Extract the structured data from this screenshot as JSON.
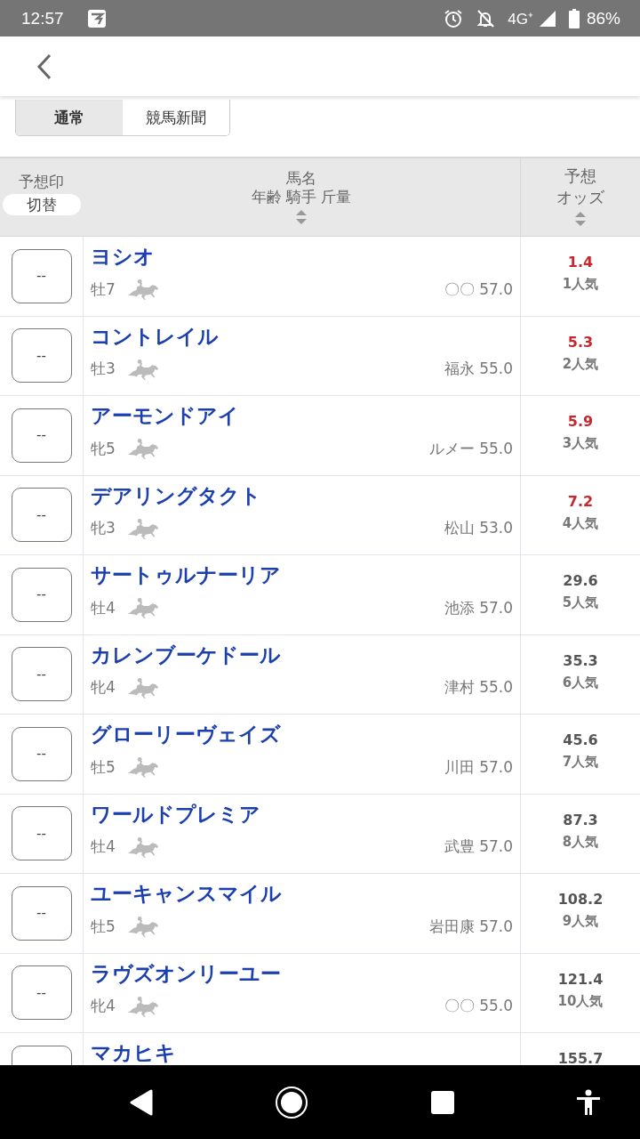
{
  "status_bar": {
    "time": "12:57",
    "network": "4G⁺",
    "battery": "86%"
  },
  "view_toggle": [
    {
      "label": "通常",
      "selected": true
    },
    {
      "label": "競馬新聞",
      "selected": false
    }
  ],
  "table": {
    "columns": [
      {
        "lines": [
          "予想印"
        ],
        "button": "切替"
      },
      {
        "lines": [
          "馬名",
          "年齢 騎手 斤量"
        ],
        "sortable": true
      },
      {
        "lines": [
          "予想",
          "オッズ"
        ],
        "sortable": true
      }
    ],
    "rows": [
      {
        "mark": "--",
        "name": "ヨシオ",
        "sex_age": "牡7",
        "jockey_weight": "〇〇 57.0",
        "odds": "1.4",
        "popularity": "1人気",
        "favored": true
      },
      {
        "mark": "--",
        "name": "コントレイル",
        "sex_age": "牡3",
        "jockey_weight": "福永 55.0",
        "odds": "5.3",
        "popularity": "2人気",
        "favored": true
      },
      {
        "mark": "--",
        "name": "アーモンドアイ",
        "sex_age": "牝5",
        "jockey_weight": "ルメー 55.0",
        "odds": "5.9",
        "popularity": "3人気",
        "favored": true
      },
      {
        "mark": "--",
        "name": "デアリングタクト",
        "sex_age": "牝3",
        "jockey_weight": "松山 53.0",
        "odds": "7.2",
        "popularity": "4人気",
        "favored": true
      },
      {
        "mark": "--",
        "name": "サートゥルナーリア",
        "sex_age": "牡4",
        "jockey_weight": "池添 57.0",
        "odds": "29.6",
        "popularity": "5人気",
        "favored": false
      },
      {
        "mark": "--",
        "name": "カレンブーケドール",
        "sex_age": "牝4",
        "jockey_weight": "津村 55.0",
        "odds": "35.3",
        "popularity": "6人気",
        "favored": false
      },
      {
        "mark": "--",
        "name": "グローリーヴェイズ",
        "sex_age": "牡5",
        "jockey_weight": "川田 57.0",
        "odds": "45.6",
        "popularity": "7人気",
        "favored": false
      },
      {
        "mark": "--",
        "name": "ワールドプレミア",
        "sex_age": "牡4",
        "jockey_weight": "武豊 57.0",
        "odds": "87.3",
        "popularity": "8人気",
        "favored": false
      },
      {
        "mark": "--",
        "name": "ユーキャンスマイル",
        "sex_age": "牡5",
        "jockey_weight": "岩田康 57.0",
        "odds": "108.2",
        "popularity": "9人気",
        "favored": false
      },
      {
        "mark": "--",
        "name": "ラヴズオンリーユー",
        "sex_age": "牝4",
        "jockey_weight": "〇〇 55.0",
        "odds": "121.4",
        "popularity": "10人気",
        "favored": false
      },
      {
        "name": "マカヒキ",
        "odds": "155.7",
        "favored": false
      }
    ]
  }
}
